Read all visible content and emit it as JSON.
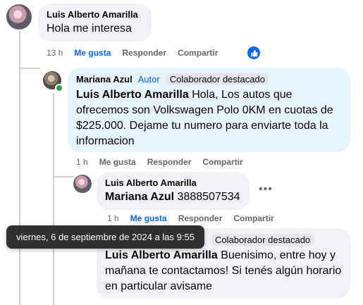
{
  "comment1": {
    "author": "Luis Alberto Amarilla",
    "text": "Hola me interesa",
    "time": "13 h",
    "like": "Me gusta",
    "reply": "Responder",
    "share": "Compartir"
  },
  "reply1": {
    "author": "Mariana Azul",
    "role": "Autor",
    "badge": "Colaborador destacado",
    "mention": "Luis Alberto Amarilla",
    "text": "Hola, Los autos que ofrecemos son Volkswagen Polo 0KM en cuotas de $225.000. Dejame tu numero para enviarte toda la informacion",
    "time": "1 h",
    "like": "Me gusta",
    "reply": "Responder",
    "share": "Compartir"
  },
  "reply2": {
    "author": "Luis Alberto Amarilla",
    "mention": "Mariana Azul",
    "text": "3888507534",
    "time": "1 h",
    "like": "Me gusta",
    "reply": "Responder",
    "share": "Compartir"
  },
  "reply3": {
    "badge": "Colaborador destacado",
    "mention": "Luis Alberto Amarilla",
    "text": "Buenisimo, entre hoy y mañana te contactamos! Si tenés algún horario en particular avisame"
  },
  "tooltip": {
    "text": "viernes, 6 de septiembre de 2024 a las 9:55"
  },
  "icons": {
    "like_reaction": "thumbs-up-icon",
    "more": "more-horizontal-icon"
  },
  "colors": {
    "link_blue": "#0866ff",
    "bubble_gray": "#f0f2f5",
    "bubble_blue": "#e7f3ff",
    "online_green": "#31a24c"
  }
}
